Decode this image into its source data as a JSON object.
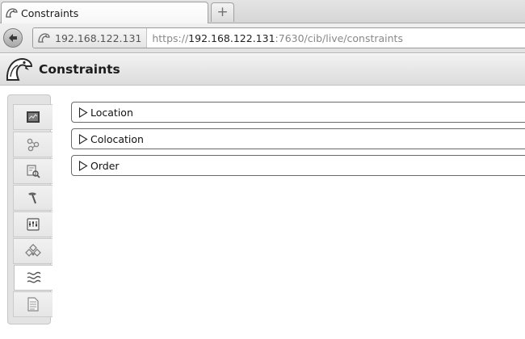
{
  "browser": {
    "tab_title": "Constraints",
    "new_tab_symbol": "+",
    "identity_host": "192.168.122.131",
    "url": {
      "scheme": "https://",
      "host": "192.168.122.131",
      "rest": ":7630/cib/live/constraints"
    }
  },
  "app": {
    "page_title": "Constraints"
  },
  "sidebar": {
    "items": [
      {
        "icon": "status-monitor-icon",
        "active": false
      },
      {
        "icon": "history-icon",
        "active": false
      },
      {
        "icon": "explorer-icon",
        "active": false
      },
      {
        "icon": "tools-icon",
        "active": false
      },
      {
        "icon": "cluster-config-icon",
        "active": false
      },
      {
        "icon": "resources-icon",
        "active": false
      },
      {
        "icon": "constraints-icon",
        "active": true
      },
      {
        "icon": "document-icon",
        "active": false
      }
    ]
  },
  "sections": [
    {
      "label": "Location"
    },
    {
      "label": "Colocation"
    },
    {
      "label": "Order"
    }
  ]
}
